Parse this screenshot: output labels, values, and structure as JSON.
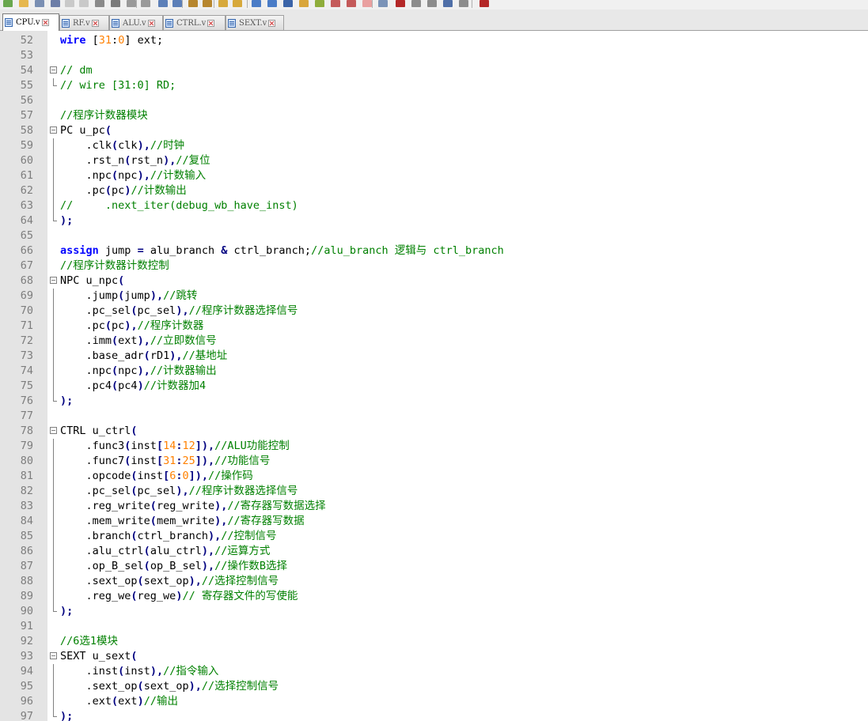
{
  "toolbar": {
    "icons": [
      "new-file-icon",
      "open-file-icon",
      "save-icon",
      "save-all-icon",
      "close-icon",
      "close-all-icon",
      "print-icon",
      "cut-icon",
      "copy-icon",
      "paste-icon",
      "undo-icon",
      "redo-icon",
      "find-icon",
      "replace-icon",
      "zoom-in-icon",
      "zoom-out-icon",
      "sync-scroll-icon",
      "wrap-icon",
      "show-all-chars-icon",
      "indent-guide-icon",
      "lang-icon",
      "doc-map-icon",
      "function-list-icon",
      "folder-workspace-icon",
      "monitor-icon",
      "record-macro-icon",
      "stop-record-icon",
      "play-macro-icon",
      "run-macro-icon",
      "save-macro-icon",
      "spellcheck-icon"
    ]
  },
  "tabs": [
    {
      "label": "CPU.v",
      "active": true
    },
    {
      "label": "RF.v",
      "active": false
    },
    {
      "label": "ALU.v",
      "active": false
    },
    {
      "label": "CTRL.v",
      "active": false
    },
    {
      "label": "SEXT.v",
      "active": false
    }
  ],
  "editor": {
    "lines": [
      {
        "n": "52",
        "fold": "",
        "tokens": [
          [
            "kw",
            "wire"
          ],
          [
            "t",
            " ["
          ],
          [
            "num",
            "31"
          ],
          [
            "t",
            ":"
          ],
          [
            "num",
            "0"
          ],
          [
            "t",
            "] ext;"
          ]
        ]
      },
      {
        "n": "53",
        "fold": "",
        "tokens": []
      },
      {
        "n": "54",
        "fold": "start",
        "tokens": [
          [
            "cm",
            "// dm"
          ]
        ]
      },
      {
        "n": "55",
        "fold": "end",
        "tokens": [
          [
            "cm",
            "// wire [31:0] RD;"
          ]
        ]
      },
      {
        "n": "56",
        "fold": "",
        "tokens": []
      },
      {
        "n": "57",
        "fold": "",
        "tokens": [
          [
            "cm",
            "//程序计数器模块"
          ]
        ]
      },
      {
        "n": "58",
        "fold": "start",
        "tokens": [
          [
            "t",
            "PC u_pc"
          ],
          [
            "op",
            "("
          ]
        ]
      },
      {
        "n": "59",
        "fold": "mid",
        "tokens": [
          [
            "t",
            "    .clk"
          ],
          [
            "op",
            "("
          ],
          [
            "t",
            "clk"
          ],
          [
            "op",
            "),"
          ],
          [
            "cm",
            "//时钟"
          ]
        ]
      },
      {
        "n": "60",
        "fold": "mid",
        "tokens": [
          [
            "t",
            "    .rst_n"
          ],
          [
            "op",
            "("
          ],
          [
            "t",
            "rst_n"
          ],
          [
            "op",
            "),"
          ],
          [
            "cm",
            "//复位"
          ]
        ]
      },
      {
        "n": "61",
        "fold": "mid",
        "tokens": [
          [
            "t",
            "    .npc"
          ],
          [
            "op",
            "("
          ],
          [
            "t",
            "npc"
          ],
          [
            "op",
            "),"
          ],
          [
            "cm",
            "//计数输入"
          ]
        ]
      },
      {
        "n": "62",
        "fold": "mid",
        "tokens": [
          [
            "t",
            "    .pc"
          ],
          [
            "op",
            "("
          ],
          [
            "t",
            "pc"
          ],
          [
            "op",
            ")"
          ],
          [
            "cm",
            "//计数输出"
          ]
        ]
      },
      {
        "n": "63",
        "fold": "mid",
        "tokens": [
          [
            "cm",
            "//     .next_iter(debug_wb_have_inst)"
          ]
        ]
      },
      {
        "n": "64",
        "fold": "end",
        "tokens": [
          [
            "op",
            ");"
          ]
        ]
      },
      {
        "n": "65",
        "fold": "",
        "tokens": []
      },
      {
        "n": "66",
        "fold": "",
        "tokens": [
          [
            "kw",
            "assign"
          ],
          [
            "t",
            " jump "
          ],
          [
            "op",
            "="
          ],
          [
            "t",
            " alu_branch "
          ],
          [
            "op",
            "&"
          ],
          [
            "t",
            " ctrl_branch;"
          ],
          [
            "cm",
            "//alu_branch 逻辑与 ctrl_branch"
          ]
        ]
      },
      {
        "n": "67",
        "fold": "",
        "tokens": [
          [
            "cm",
            "//程序计数器计数控制"
          ]
        ]
      },
      {
        "n": "68",
        "fold": "start",
        "tokens": [
          [
            "t",
            "NPC u_npc"
          ],
          [
            "op",
            "("
          ]
        ]
      },
      {
        "n": "69",
        "fold": "mid",
        "tokens": [
          [
            "t",
            "    .jump"
          ],
          [
            "op",
            "("
          ],
          [
            "t",
            "jump"
          ],
          [
            "op",
            "),"
          ],
          [
            "cm",
            "//跳转"
          ]
        ]
      },
      {
        "n": "70",
        "fold": "mid",
        "tokens": [
          [
            "t",
            "    .pc_sel"
          ],
          [
            "op",
            "("
          ],
          [
            "t",
            "pc_sel"
          ],
          [
            "op",
            "),"
          ],
          [
            "cm",
            "//程序计数器选择信号"
          ]
        ]
      },
      {
        "n": "71",
        "fold": "mid",
        "tokens": [
          [
            "t",
            "    .pc"
          ],
          [
            "op",
            "("
          ],
          [
            "t",
            "pc"
          ],
          [
            "op",
            "),"
          ],
          [
            "cm",
            "//程序计数器"
          ]
        ]
      },
      {
        "n": "72",
        "fold": "mid",
        "tokens": [
          [
            "t",
            "    .imm"
          ],
          [
            "op",
            "("
          ],
          [
            "t",
            "ext"
          ],
          [
            "op",
            "),"
          ],
          [
            "cm",
            "//立即数信号"
          ]
        ]
      },
      {
        "n": "73",
        "fold": "mid",
        "tokens": [
          [
            "t",
            "    .base_adr"
          ],
          [
            "op",
            "("
          ],
          [
            "t",
            "rD1"
          ],
          [
            "op",
            "),"
          ],
          [
            "cm",
            "//基地址"
          ]
        ]
      },
      {
        "n": "74",
        "fold": "mid",
        "tokens": [
          [
            "t",
            "    .npc"
          ],
          [
            "op",
            "("
          ],
          [
            "t",
            "npc"
          ],
          [
            "op",
            "),"
          ],
          [
            "cm",
            "//计数器输出"
          ]
        ]
      },
      {
        "n": "75",
        "fold": "mid",
        "tokens": [
          [
            "t",
            "    .pc4"
          ],
          [
            "op",
            "("
          ],
          [
            "t",
            "pc4"
          ],
          [
            "op",
            ")"
          ],
          [
            "cm",
            "//计数器加4"
          ]
        ]
      },
      {
        "n": "76",
        "fold": "end",
        "tokens": [
          [
            "op",
            ");"
          ]
        ]
      },
      {
        "n": "77",
        "fold": "",
        "tokens": []
      },
      {
        "n": "78",
        "fold": "start",
        "tokens": [
          [
            "t",
            "CTRL u_ctrl"
          ],
          [
            "op",
            "("
          ]
        ]
      },
      {
        "n": "79",
        "fold": "mid",
        "tokens": [
          [
            "t",
            "    .func3"
          ],
          [
            "op",
            "("
          ],
          [
            "t",
            "inst"
          ],
          [
            "op",
            "["
          ],
          [
            "num",
            "14"
          ],
          [
            "op",
            ":"
          ],
          [
            "num",
            "12"
          ],
          [
            "op",
            "]),"
          ],
          [
            "cm",
            "//ALU功能控制"
          ]
        ]
      },
      {
        "n": "80",
        "fold": "mid",
        "tokens": [
          [
            "t",
            "    .func7"
          ],
          [
            "op",
            "("
          ],
          [
            "t",
            "inst"
          ],
          [
            "op",
            "["
          ],
          [
            "num",
            "31"
          ],
          [
            "op",
            ":"
          ],
          [
            "num",
            "25"
          ],
          [
            "op",
            "]),"
          ],
          [
            "cm",
            "//功能信号"
          ]
        ]
      },
      {
        "n": "81",
        "fold": "mid",
        "tokens": [
          [
            "t",
            "    .opcode"
          ],
          [
            "op",
            "("
          ],
          [
            "t",
            "inst"
          ],
          [
            "op",
            "["
          ],
          [
            "num",
            "6"
          ],
          [
            "op",
            ":"
          ],
          [
            "num",
            "0"
          ],
          [
            "op",
            "]),"
          ],
          [
            "cm",
            "//操作码"
          ]
        ]
      },
      {
        "n": "82",
        "fold": "mid",
        "tokens": [
          [
            "t",
            "    .pc_sel"
          ],
          [
            "op",
            "("
          ],
          [
            "t",
            "pc_sel"
          ],
          [
            "op",
            "),"
          ],
          [
            "cm",
            "//程序计数器选择信号"
          ]
        ]
      },
      {
        "n": "83",
        "fold": "mid",
        "tokens": [
          [
            "t",
            "    .reg_write"
          ],
          [
            "op",
            "("
          ],
          [
            "t",
            "reg_write"
          ],
          [
            "op",
            "),"
          ],
          [
            "cm",
            "//寄存器写数据选择"
          ]
        ]
      },
      {
        "n": "84",
        "fold": "mid",
        "tokens": [
          [
            "t",
            "    .mem_write"
          ],
          [
            "op",
            "("
          ],
          [
            "t",
            "mem_write"
          ],
          [
            "op",
            "),"
          ],
          [
            "cm",
            "//寄存器写数据"
          ]
        ]
      },
      {
        "n": "85",
        "fold": "mid",
        "tokens": [
          [
            "t",
            "    .branch"
          ],
          [
            "op",
            "("
          ],
          [
            "t",
            "ctrl_branch"
          ],
          [
            "op",
            "),"
          ],
          [
            "cm",
            "//控制信号"
          ]
        ]
      },
      {
        "n": "86",
        "fold": "mid",
        "tokens": [
          [
            "t",
            "    .alu_ctrl"
          ],
          [
            "op",
            "("
          ],
          [
            "t",
            "alu_ctrl"
          ],
          [
            "op",
            "),"
          ],
          [
            "cm",
            "//运算方式"
          ]
        ]
      },
      {
        "n": "87",
        "fold": "mid",
        "tokens": [
          [
            "t",
            "    .op_B_sel"
          ],
          [
            "op",
            "("
          ],
          [
            "t",
            "op_B_sel"
          ],
          [
            "op",
            "),"
          ],
          [
            "cm",
            "//操作数B选择"
          ]
        ]
      },
      {
        "n": "88",
        "fold": "mid",
        "tokens": [
          [
            "t",
            "    .sext_op"
          ],
          [
            "op",
            "("
          ],
          [
            "t",
            "sext_op"
          ],
          [
            "op",
            "),"
          ],
          [
            "cm",
            "//选择控制信号"
          ]
        ]
      },
      {
        "n": "89",
        "fold": "mid",
        "tokens": [
          [
            "t",
            "    .reg_we"
          ],
          [
            "op",
            "("
          ],
          [
            "t",
            "reg_we"
          ],
          [
            "op",
            ")"
          ],
          [
            "cm",
            "// 寄存器文件的写使能"
          ]
        ]
      },
      {
        "n": "90",
        "fold": "end",
        "tokens": [
          [
            "op",
            ");"
          ]
        ]
      },
      {
        "n": "91",
        "fold": "",
        "tokens": []
      },
      {
        "n": "92",
        "fold": "",
        "tokens": [
          [
            "cm",
            "//6选1模块"
          ]
        ]
      },
      {
        "n": "93",
        "fold": "start",
        "tokens": [
          [
            "t",
            "SEXT u_sext"
          ],
          [
            "op",
            "("
          ]
        ]
      },
      {
        "n": "94",
        "fold": "mid",
        "tokens": [
          [
            "t",
            "    .inst"
          ],
          [
            "op",
            "("
          ],
          [
            "t",
            "inst"
          ],
          [
            "op",
            "),"
          ],
          [
            "cm",
            "//指令输入"
          ]
        ]
      },
      {
        "n": "95",
        "fold": "mid",
        "tokens": [
          [
            "t",
            "    .sext_op"
          ],
          [
            "op",
            "("
          ],
          [
            "t",
            "sext_op"
          ],
          [
            "op",
            "),"
          ],
          [
            "cm",
            "//选择控制信号"
          ]
        ]
      },
      {
        "n": "96",
        "fold": "mid",
        "tokens": [
          [
            "t",
            "    .ext"
          ],
          [
            "op",
            "("
          ],
          [
            "t",
            "ext"
          ],
          [
            "op",
            ")"
          ],
          [
            "cm",
            "//输出"
          ]
        ]
      },
      {
        "n": "97",
        "fold": "end",
        "tokens": [
          [
            "op",
            ");"
          ]
        ]
      }
    ]
  }
}
